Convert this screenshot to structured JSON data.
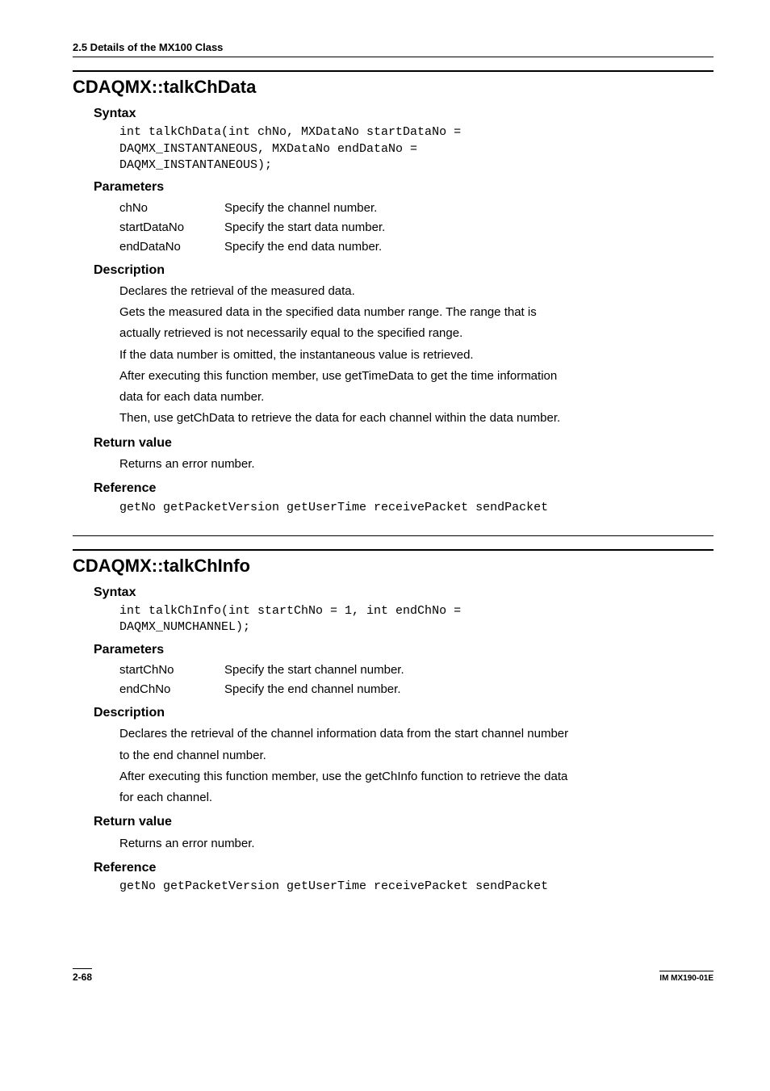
{
  "header": "2.5  Details of the MX100 Class",
  "func1": {
    "title": "CDAQMX::talkChData",
    "syntax_head": "Syntax",
    "syntax_code": "int talkChData(int chNo, MXDataNo startDataNo =\nDAQMX_INSTANTANEOUS, MXDataNo endDataNo =\nDAQMX_INSTANTANEOUS);",
    "params_head": "Parameters",
    "params": [
      {
        "name": "chNo",
        "desc": "Specify the channel number."
      },
      {
        "name": "startDataNo",
        "desc": "Specify the start data number."
      },
      {
        "name": "endDataNo",
        "desc": "Specify the end data number."
      }
    ],
    "desc_head": "Description",
    "desc_lines": [
      "Declares the retrieval of the measured data.",
      "Gets the measured data in the specified data number range. The range that is",
      "actually retrieved is not necessarily equal to the specified range.",
      "If the data number is omitted, the instantaneous value is retrieved.",
      "After executing this function member, use getTimeData to get the time information",
      "data for each data number.",
      "Then, use getChData to retrieve the data for each channel within the data number."
    ],
    "ret_head": "Return value",
    "ret_text": "Returns an error number.",
    "ref_head": "Reference",
    "ref_code": "getNo getPacketVersion getUserTime receivePacket sendPacket"
  },
  "func2": {
    "title": "CDAQMX::talkChInfo",
    "syntax_head": "Syntax",
    "syntax_code": "int talkChInfo(int startChNo = 1, int endChNo =\nDAQMX_NUMCHANNEL);",
    "params_head": "Parameters",
    "params": [
      {
        "name": "startChNo",
        "desc": "Specify the start channel number."
      },
      {
        "name": "endChNo",
        "desc": "Specify the end channel number."
      }
    ],
    "desc_head": "Description",
    "desc_lines": [
      "Declares the retrieval of the channel information data from the start channel number",
      "to the end channel number.",
      "After executing this function member, use the getChInfo function to retrieve the data",
      "for each channel."
    ],
    "ret_head": "Return value",
    "ret_text": "Returns an error number.",
    "ref_head": "Reference",
    "ref_code": "getNo getPacketVersion getUserTime receivePacket sendPacket"
  },
  "footer": {
    "page": "2-68",
    "docid": "IM MX190-01E"
  }
}
